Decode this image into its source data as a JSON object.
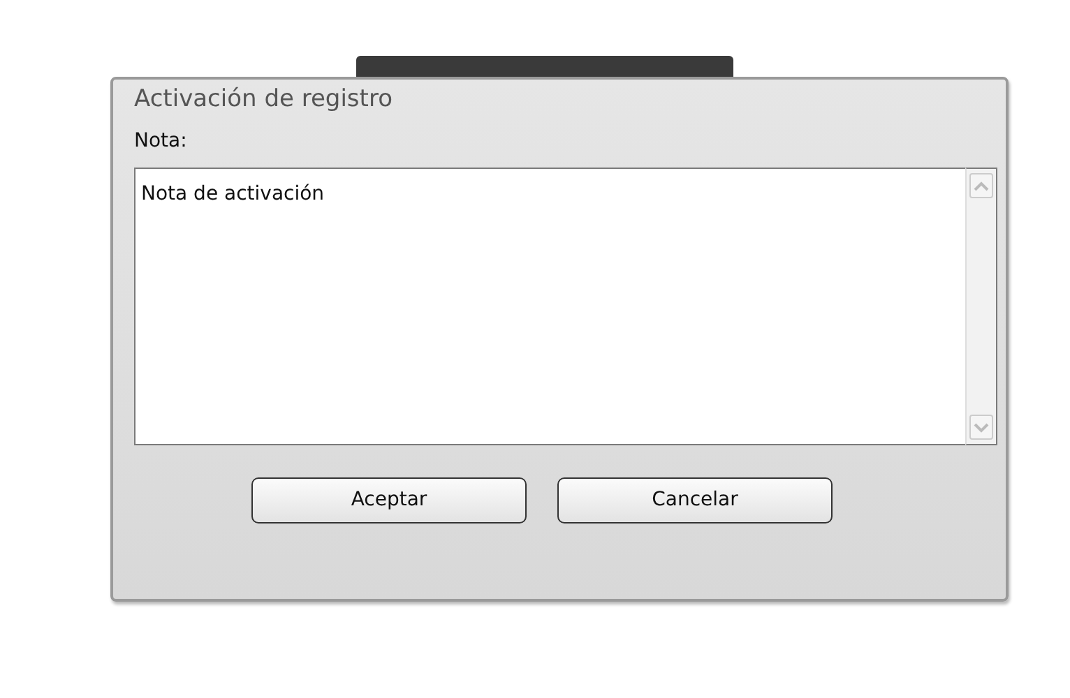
{
  "dialog": {
    "title": "Activación de registro",
    "note_label": "Nota:",
    "note": {
      "value": "Nota de activación"
    },
    "buttons": [
      {
        "label": "Aceptar"
      },
      {
        "label": "Cancelar"
      }
    ]
  }
}
